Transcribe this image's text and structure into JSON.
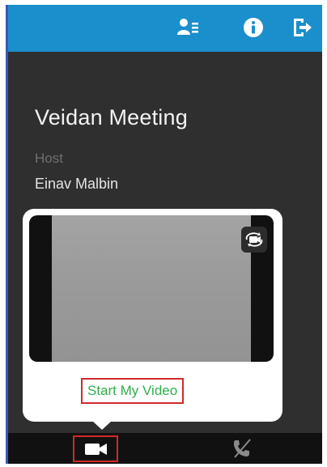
{
  "meeting": {
    "title": "Veidan Meeting",
    "host_label": "Host",
    "host_name": "Einav Malbin"
  },
  "popover": {
    "start_video_label": "Start My Video"
  },
  "icons": {
    "participants": "participants-icon",
    "info": "info-icon",
    "leave": "leave-icon",
    "switch_camera": "switch-camera-icon",
    "video": "video-camera-icon",
    "end_call": "end-call-icon"
  },
  "colors": {
    "topbar": "#1b8fcb",
    "background": "#2f2f2f",
    "start_video_text": "#2fae4a",
    "highlight_box": "#d02a2a"
  }
}
